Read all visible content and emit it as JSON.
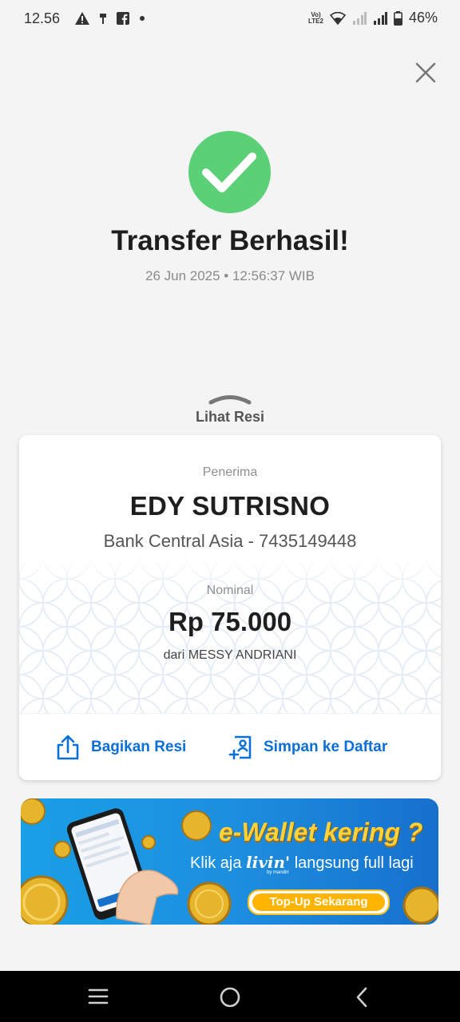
{
  "status_bar": {
    "time": "12.56",
    "battery": "46%",
    "network_labels": [
      "Vo)",
      "LTE2"
    ]
  },
  "result": {
    "title": "Transfer Berhasil!",
    "datetime": "26 Jun 2025 • 12:56:37 WIB",
    "status_color": "#5bd077"
  },
  "receipt_toggle": {
    "label": "Lihat Resi"
  },
  "receipt": {
    "recipient_label": "Penerima",
    "recipient_name": "EDY SUTRISNO",
    "recipient_bank": "Bank Central Asia - 7435149448",
    "amount_label": "Nominal",
    "amount": "Rp 75.000",
    "sender": "dari MESSY ANDRIANI"
  },
  "actions": {
    "share_label": "Bagikan Resi",
    "save_label": "Simpan ke Daftar",
    "accent_color": "#0a6fd6"
  },
  "banner": {
    "title": "e-Wallet kering ?",
    "subtitle_prefix": "Klik aja",
    "brand": "livin'",
    "brand_tag": "by mandiri",
    "subtitle_suffix": "langsung full lagi",
    "cta": "Top-Up Sekarang"
  },
  "icons": {
    "close": "close-icon",
    "success": "check-icon",
    "share": "share-icon",
    "save": "save-contact-icon"
  }
}
